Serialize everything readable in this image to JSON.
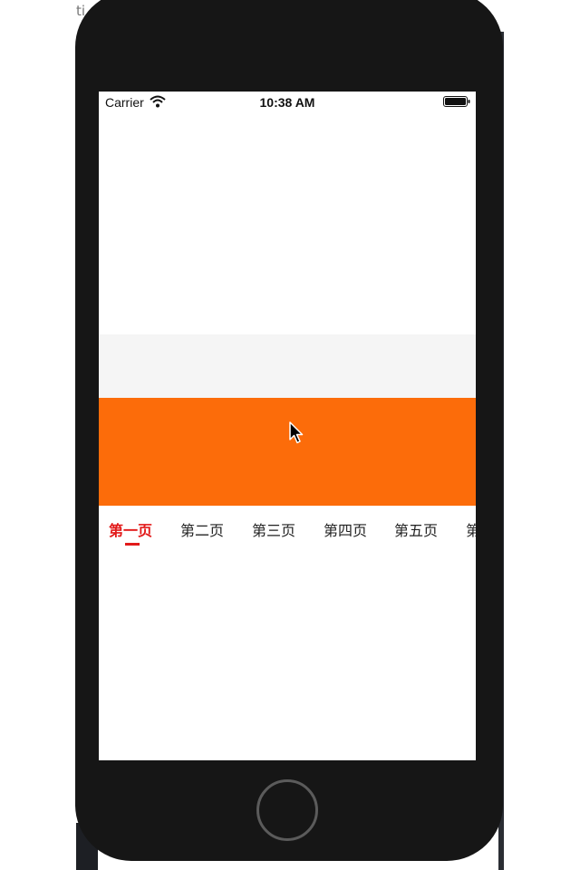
{
  "simulator": {
    "corner_text": "ti"
  },
  "status_bar": {
    "carrier": "Carrier",
    "time": "10:38 AM",
    "wifi_icon": "wifi-icon",
    "battery_icon": "battery-full-icon"
  },
  "banner": {
    "color": "#fc6c0a",
    "cursor_icon": "mouse-pointer-icon"
  },
  "tabs": {
    "items": [
      {
        "label": "第一页"
      },
      {
        "label": "第二页"
      },
      {
        "label": "第三页"
      },
      {
        "label": "第四页"
      },
      {
        "label": "第五页"
      },
      {
        "label": "第"
      }
    ],
    "active_color": "#e21a1a"
  },
  "home_button": {
    "icon": "home-button-icon"
  }
}
